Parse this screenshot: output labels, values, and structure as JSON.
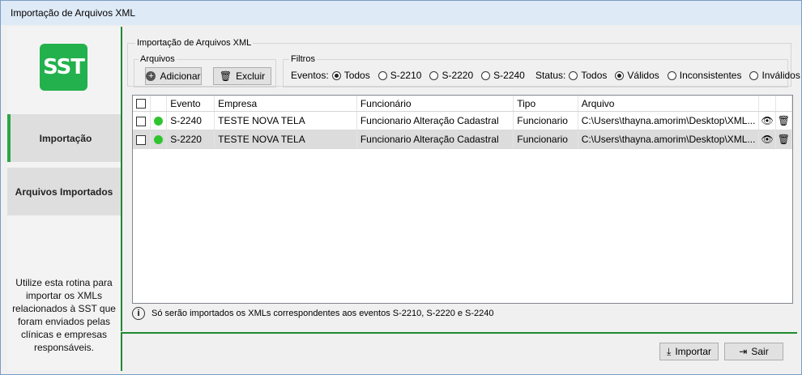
{
  "window": {
    "title": "Importação de Arquivos XML"
  },
  "sidebar": {
    "logo_text": "SST",
    "items": [
      {
        "label": "Importação"
      },
      {
        "label": "Arquivos Importados"
      }
    ],
    "help_text": "Utilize esta rotina para importar os XMLs relacionados à SST que foram enviados pelas clínicas e empresas responsáveis."
  },
  "main": {
    "group_title": "Importação de Arquivos XML",
    "arquivos": {
      "legend": "Arquivos",
      "add_label": "Adicionar",
      "delete_label": "Excluir"
    },
    "filtros": {
      "legend": "Filtros",
      "eventos_label": "Eventos:",
      "eventos_options": [
        "Todos",
        "S-2210",
        "S-2220",
        "S-2240"
      ],
      "eventos_selected": "Todos",
      "status_label": "Status:",
      "status_options": [
        "Todos",
        "Válidos",
        "Inconsistentes",
        "Inválidos"
      ],
      "status_selected": "Válidos"
    },
    "table": {
      "columns": [
        "Evento",
        "Empresa",
        "Funcionário",
        "Tipo",
        "Arquivo"
      ],
      "rows": [
        {
          "evento": "S-2240",
          "empresa": "TESTE NOVA TELA",
          "funcionario": "Funcionario Alteração Cadastral",
          "tipo": "Funcionario",
          "arquivo": "C:\\Users\\thayna.amorim\\Desktop\\XML..."
        },
        {
          "evento": "S-2220",
          "empresa": "TESTE NOVA TELA",
          "funcionario": "Funcionario Alteração Cadastral",
          "tipo": "Funcionario",
          "arquivo": "C:\\Users\\thayna.amorim\\Desktop\\XML..."
        }
      ]
    },
    "info_text": "Só serão importados os XMLs correspondentes aos eventos S-2210, S-2220 e S-2240"
  },
  "footer": {
    "import_label": "Importar",
    "exit_label": "Sair"
  },
  "colors": {
    "accent": "#1e8a2e",
    "logo": "#22b14c",
    "status_dot": "#31c431"
  }
}
